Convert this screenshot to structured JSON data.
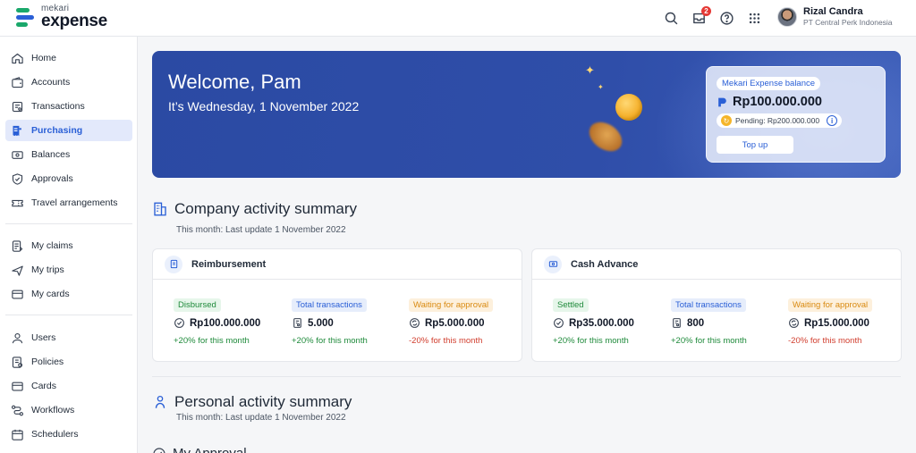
{
  "brand": {
    "small": "mekari",
    "big": "expense"
  },
  "topbar": {
    "notification_count": "2"
  },
  "user": {
    "name": "Rizal Candra",
    "company": "PT Central Perk Indonesia"
  },
  "sidebar": {
    "group1": [
      {
        "label": "Home",
        "icon": "home-icon"
      },
      {
        "label": "Accounts",
        "icon": "wallet-icon"
      },
      {
        "label": "Transactions",
        "icon": "transactions-icon"
      },
      {
        "label": "Purchasing",
        "icon": "purchasing-icon",
        "active": true
      },
      {
        "label": "Balances",
        "icon": "balance-icon"
      },
      {
        "label": "Approvals",
        "icon": "shield-check-icon"
      },
      {
        "label": "Travel arrangements",
        "icon": "ticket-icon"
      }
    ],
    "group2": [
      {
        "label": "My claims",
        "icon": "claims-icon"
      },
      {
        "label": "My trips",
        "icon": "plane-icon"
      },
      {
        "label": "My cards",
        "icon": "card-icon"
      }
    ],
    "group3": [
      {
        "label": "Users",
        "icon": "user-icon"
      },
      {
        "label": "Policies",
        "icon": "policy-icon"
      },
      {
        "label": "Cards",
        "icon": "card-icon"
      },
      {
        "label": "Workflows",
        "icon": "workflow-icon"
      },
      {
        "label": "Schedulers",
        "icon": "calendar-icon"
      }
    ]
  },
  "hero": {
    "title": "Welcome, Pam",
    "date": "It’s Wednesday, 1 November 2022",
    "balance_label": "Mekari Expense balance",
    "balance_amount": "Rp100.000.000",
    "pending": "Pending: Rp200.000.000",
    "topup_label": "Top up"
  },
  "company_summary": {
    "title": "Company activity summary",
    "subtitle": "This month: Last update 1 November 2022",
    "reimbursement": {
      "title": "Reimbursement",
      "metrics": [
        {
          "tag": "Disbursed",
          "value": "Rp100.000.000",
          "change": "+20% for this month"
        },
        {
          "tag": "Total transactions",
          "value": "5.000",
          "change": "+20% for this month"
        },
        {
          "tag": "Waiting for approval",
          "value": "Rp5.000.000",
          "change": "-20% for this month"
        }
      ]
    },
    "cash_advance": {
      "title": "Cash Advance",
      "metrics": [
        {
          "tag": "Settled",
          "value": "Rp35.000.000",
          "change": "+20% for this month"
        },
        {
          "tag": "Total transactions",
          "value": "800",
          "change": "+20% for this month"
        },
        {
          "tag": "Waiting for approval",
          "value": "Rp15.000.000",
          "change": "-20% for this month"
        }
      ]
    }
  },
  "personal_summary": {
    "title": "Personal activity summary",
    "subtitle": "This month: Last update 1 November 2022",
    "next_title": "My Approval"
  },
  "colors": {
    "primary": "#2a5fd6",
    "hero_bg": "#2f4ea9",
    "positive": "#1f8a3b",
    "negative": "#d13d2d"
  }
}
